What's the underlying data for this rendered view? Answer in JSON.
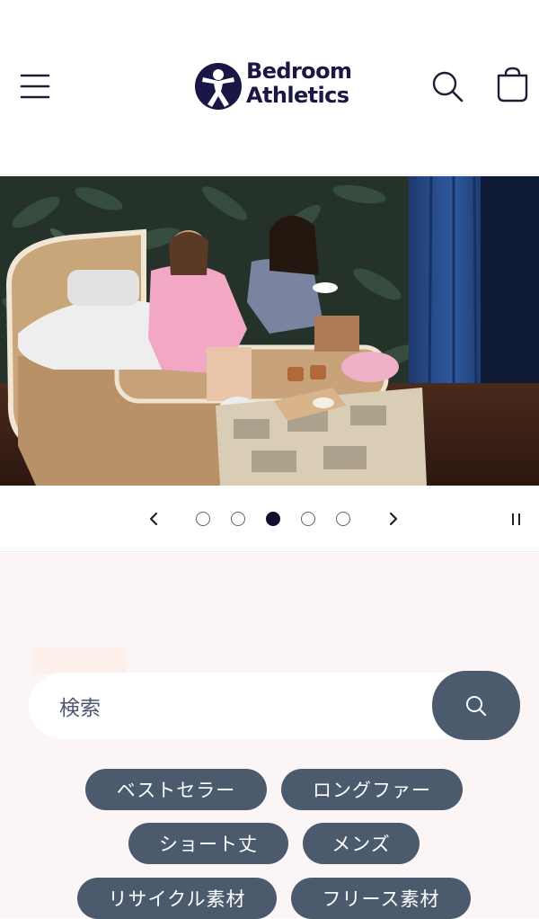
{
  "header": {
    "logo_line1": "Bedroom",
    "logo_line2": "Athletics",
    "menu_icon": "hamburger-menu-icon",
    "search_icon": "search-icon",
    "cart_icon": "shopping-bag-icon"
  },
  "slideshow": {
    "slide_count": 5,
    "active_index": 3,
    "prev_icon": "chevron-left-icon",
    "next_icon": "chevron-right-icon",
    "pause_icon": "pause-icon"
  },
  "search": {
    "placeholder": "検索",
    "button_icon": "search-icon"
  },
  "quick_links": [
    {
      "label": "ベストセラー"
    },
    {
      "label": "ロングファー"
    },
    {
      "label": "ショート丈"
    },
    {
      "label": "メンズ"
    },
    {
      "label": "リサイクル素材"
    },
    {
      "label": "フリース素材"
    }
  ],
  "colors": {
    "brand_navy": "#1a1746",
    "button_slate": "#4b5a6c",
    "section_bg": "#fcf5f5"
  }
}
